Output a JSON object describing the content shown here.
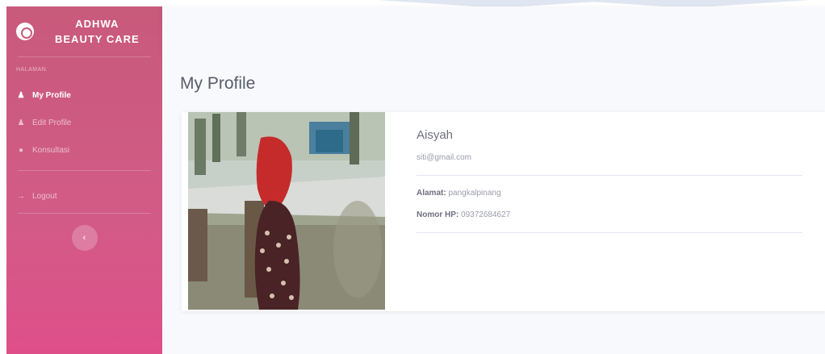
{
  "brand": {
    "line1": "ADHWA",
    "line2": "BEAUTY CARE",
    "icon": "flower-icon"
  },
  "sidebar": {
    "heading": "Halaman",
    "items": [
      {
        "label": "My Profile",
        "icon": "user-icon"
      },
      {
        "label": "Edit Profile",
        "icon": "user-edit-icon"
      },
      {
        "label": "Konsultasi",
        "icon": "chat-icon"
      },
      {
        "label": "Logout",
        "icon": "logout-icon"
      }
    ],
    "toggle": "sidebar-toggle-icon"
  },
  "main": {
    "title": "My Profile"
  },
  "profile": {
    "name": "Aisyah",
    "email": "siti@gmail.com",
    "address_label": "Alamat:",
    "address": "pangkalpinang",
    "phone_label": "Nomor HP:",
    "phone": "09372684627"
  },
  "colors": {
    "sidebar_top": "#c85a7c",
    "sidebar_bottom": "#de4f8a",
    "text": "#5a5c69"
  }
}
